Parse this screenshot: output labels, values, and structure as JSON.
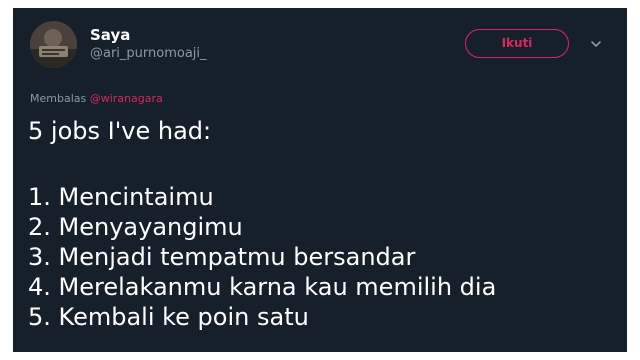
{
  "user": {
    "display_name": "Saya",
    "handle": "@ari_purnomoaji_"
  },
  "follow_button": {
    "label": "Ikuti"
  },
  "reply": {
    "prefix": "Membalas",
    "mention": "@wiranagara"
  },
  "tweet": {
    "heading": "5 jobs I've had:",
    "items": [
      "1. Mencintaimu",
      "2. Menyayangimu",
      "3. Menjadi tempatmu bersandar",
      "4. Merelakanmu karna kau memilih dia",
      "5. Kembali ke poin satu"
    ]
  },
  "icons": {
    "more_menu": "chevron-down-icon",
    "avatar": "avatar"
  },
  "colors": {
    "background": "#15202b",
    "accent": "#e0245e",
    "secondary_text": "#8899a6",
    "primary_text": "#ffffff"
  }
}
